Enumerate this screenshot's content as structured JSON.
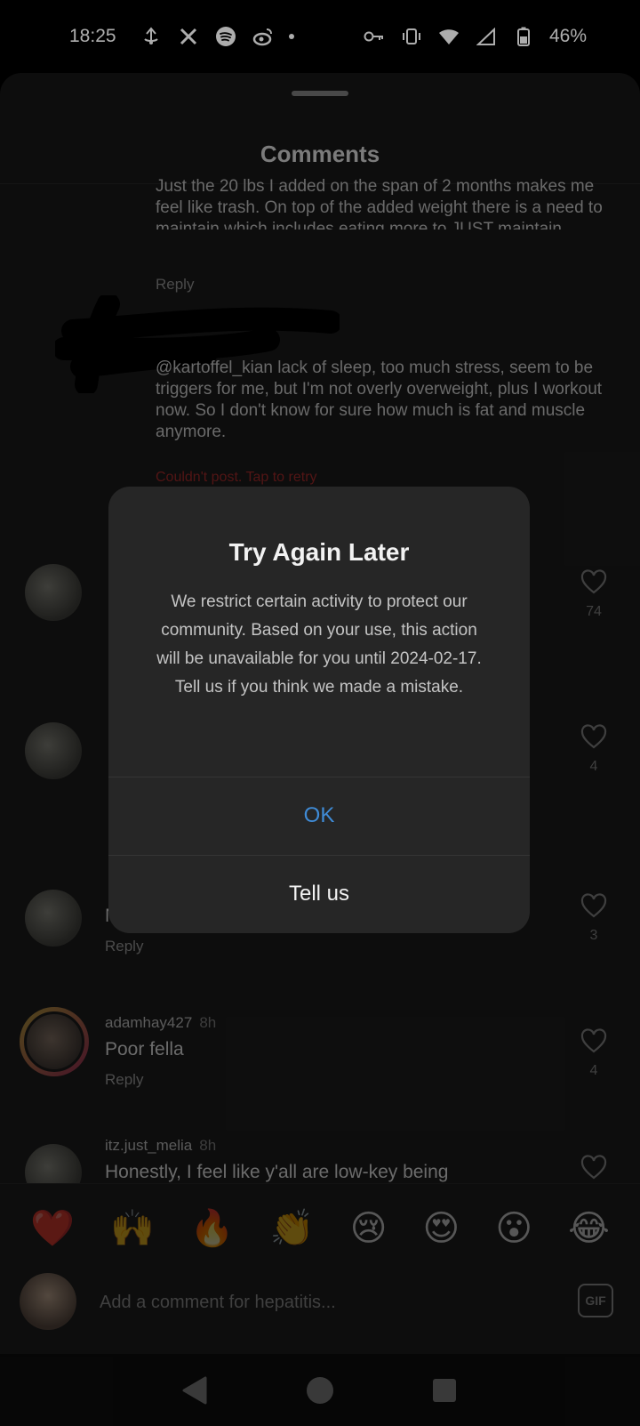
{
  "status_bar": {
    "time": "18:25",
    "battery": "46%",
    "icons_left": [
      "usb-debug-icon",
      "x-icon",
      "spotify-icon",
      "weibo-icon",
      "notification-dot"
    ],
    "icons_right": [
      "vpn-key-icon",
      "vibrate-icon",
      "wifi-icon",
      "signal-icon",
      "battery-icon"
    ]
  },
  "sheet": {
    "title": "Comments"
  },
  "reply_thread": {
    "partial_text": "Just the 20 lbs I added on the span of 2 months makes me feel like trash. On top of the added weight there is a need to maintain which includes eating more to JUST maintain.",
    "reply_label": "Reply",
    "pending_comment": "@kartoffel_kian lack of sleep, too much stress, seem to be triggers for me, but I'm not overly overweight, plus I workout now. So I don't know for sure how much is fat and muscle anymore.",
    "error_text": "Couldn't post. Tap to retry"
  },
  "comments": [
    {
      "username": "",
      "time": "",
      "text": "",
      "reply": "",
      "likes": "74"
    },
    {
      "username": "",
      "time": "",
      "text": "",
      "reply": "",
      "likes": "4"
    },
    {
      "username": "",
      "time": "",
      "text": "N",
      "reply": "Reply",
      "likes": "3"
    },
    {
      "username": "adamhay427",
      "time": "8h",
      "text": "Poor fella",
      "reply": "Reply",
      "likes": "4"
    },
    {
      "username": "itz.just_melia",
      "time": "8h",
      "text": "Honestly, I feel like y'all are low-key being",
      "reply": "",
      "likes": ""
    }
  ],
  "emoji_bar": [
    "❤️",
    "🙌",
    "🔥",
    "👏",
    "😢",
    "😍",
    "😮",
    "😂"
  ],
  "input": {
    "placeholder": "Add a comment for hepatitis...",
    "gif_label": "GIF"
  },
  "dialog": {
    "title": "Try Again Later",
    "message": "We restrict certain activity to protect our community. Based on your use, this action will be unavailable for you until 2024-02-17. Tell us if you think we made a mistake.",
    "ok_label": "OK",
    "tell_us_label": "Tell us"
  },
  "colors": {
    "ok_button": "#3f8bd6",
    "dialog_bg": "#262626",
    "sheet_bg": "#141414",
    "error_text": "#7a1f1f"
  }
}
